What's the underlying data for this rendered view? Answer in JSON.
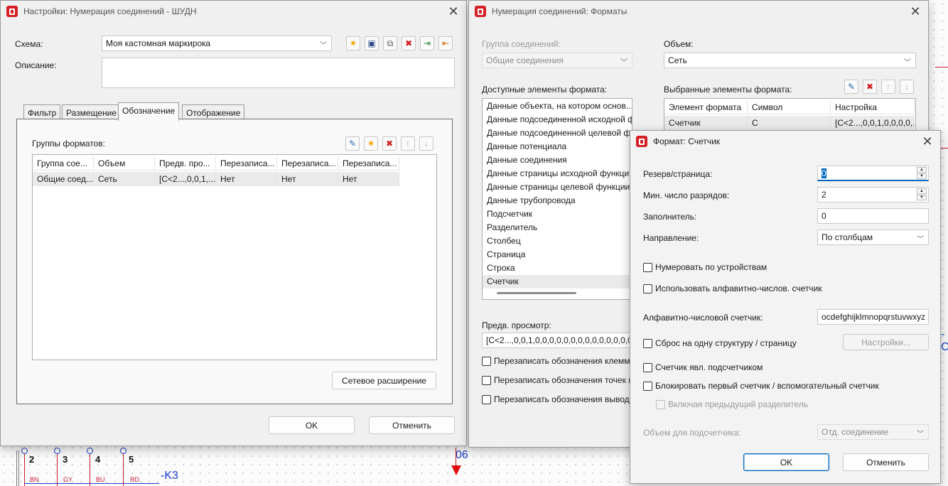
{
  "schematic": {
    "pins": [
      "2",
      "3",
      "4",
      "5"
    ],
    "wires": [
      "BN",
      "GY",
      "BU",
      "RD"
    ],
    "k3_label": "-K3",
    "terminal_label": "06"
  },
  "dialog1": {
    "title": "Настройки: Нумерация соединений - ШУДН",
    "scheme_label": "Схема:",
    "scheme_value": "Моя кастомная маркирокa",
    "description_label": "Описание:",
    "tabs": [
      "Фильтр",
      "Размещение",
      "Обозначение",
      "Отображение"
    ],
    "active_tab": "Обозначение",
    "groups_label": "Группы форматов:",
    "table": {
      "columns": [
        "Группа сое...",
        "Объем",
        "Предв. про...",
        "Перезаписа...",
        "Перезаписа...",
        "Перезаписа..."
      ],
      "rows": [
        [
          "Общие соед...",
          "Сеть",
          "[C<2...,0,0,1,...",
          "Нет",
          "Нет",
          "Нет"
        ]
      ]
    },
    "net_extension_button": "Сетевое расширение",
    "ok": "OK",
    "cancel": "Отменить"
  },
  "dialog2": {
    "title": "Нумерация соединений: Форматы",
    "group_label": "Группа соединений:",
    "group_value": "Общие соединения",
    "volume_label": "Объем:",
    "volume_value": "Сеть",
    "available_label": "Доступные элементы формата:",
    "available_items": [
      "Данные объекта, на котором основ...",
      "Данные подсоединенной исходной ф",
      "Данные подсоединенной целевой фу",
      "Данные потенциала",
      "Данные соединения",
      "Данные страницы исходной функции",
      "Данные страницы целевой функции",
      "Данные трубопровода",
      "Подсчетчик",
      "Разделитель",
      "Столбец",
      "Страница",
      "Строка",
      "Счетчик"
    ],
    "selected_available": "Счетчик",
    "selected_label": "Выбранные элементы формата:",
    "selected_columns": [
      "Элемент формата",
      "Символ",
      "Настройка"
    ],
    "selected_rows": [
      [
        "Счетчик",
        "C",
        "[C<2...,0,0,1,0,0,0,0,..."
      ]
    ],
    "preview_label": "Предв. просмотр:",
    "preview_value": "[C<2...,0,0,1,0,0,0,0,0,0,0,0,0,0,0,0,0,0,0,0,0",
    "checkboxes": [
      "Перезаписать обозначения клемм",
      "Перезаписать обозначения точек п",
      "Перезаписать обозначения выводо"
    ]
  },
  "dialog3": {
    "title": "Формат: Счетчик",
    "fields": {
      "reserve_label": "Резерв/страница:",
      "reserve_value": "0",
      "min_digits_label": "Мин. число разрядов:",
      "min_digits_value": "2",
      "filler_label": "Заполнитель:",
      "filler_value": "0",
      "direction_label": "Направление:",
      "direction_value": "По столбцам"
    },
    "cb_by_devices": "Нумеровать по устройствам",
    "cb_alnum": "Использовать алфавитно-числов. счетчик",
    "alnum_label": "Алфавитно-числовой счетчик:",
    "alnum_value": "ocdefghijklmnopqrstuvwxyz",
    "cb_reset": "Сброс на одну структуру / страницу",
    "settings_button": "Настройки...",
    "cb_subcounter": "Счетчик явл. подсчетчиком",
    "cb_block_first": "Блокировать первый счетчик / вспомогательный счетчик",
    "cb_include_prev": "Включая предыдущий разделитель",
    "subcounter_volume_label": "Объем для подсчетчика:",
    "subcounter_volume_value": "Отд. соединение",
    "ok": "OK",
    "cancel": "Отменить"
  },
  "colors": {
    "accent": "#0067c0",
    "brand": "#d41f26",
    "wire": "#cc1a2b",
    "schematic_blue": "#1a3ec8"
  }
}
